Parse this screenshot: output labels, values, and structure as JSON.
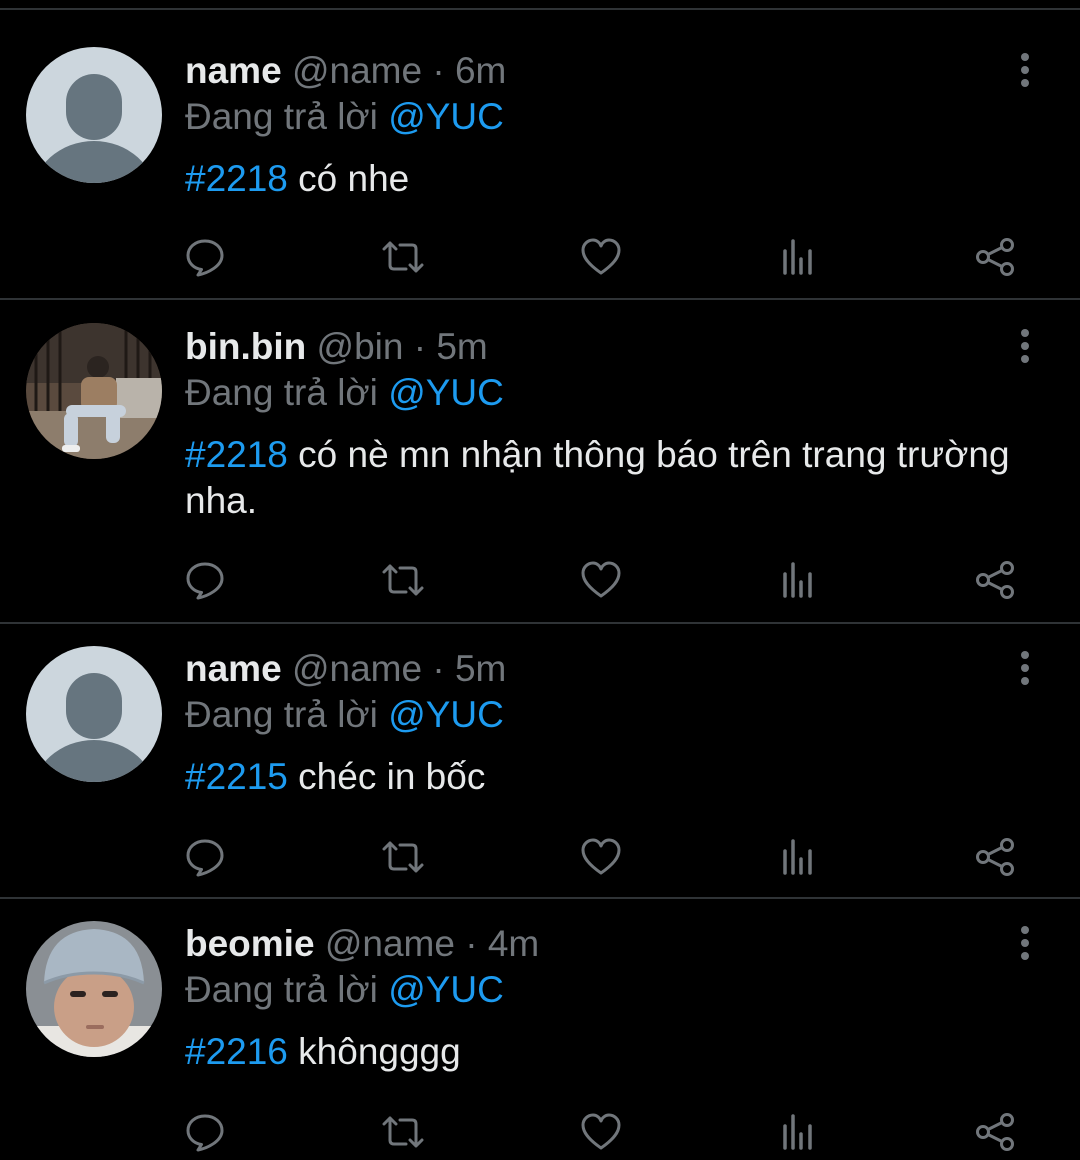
{
  "accent_color": "#1d9bf0",
  "muted_color": "#71767b",
  "tweets": [
    {
      "display_name": "name",
      "handle": "@name",
      "separator": "·",
      "time": "6m",
      "reply_prefix": "Đang trả lời",
      "reply_to": "@YUC",
      "hashtag": "#2218",
      "text": " có nhe",
      "avatar": "default-avatar-icon"
    },
    {
      "display_name": "bin.bin",
      "handle": "@bin",
      "separator": "·",
      "time": "5m",
      "reply_prefix": "Đang trả lời",
      "reply_to": "@YUC",
      "hashtag": "#2218",
      "text": " có nè mn nhận thông báo trên trang trường nha.",
      "avatar": "photo-avatar-sitting-person"
    },
    {
      "display_name": "name",
      "handle": "@name",
      "separator": "·",
      "time": "5m",
      "reply_prefix": "Đang trả lời",
      "reply_to": "@YUC",
      "hashtag": "#2215",
      "text": " chéc in bốc",
      "avatar": "default-avatar-icon"
    },
    {
      "display_name": "beomie",
      "handle": "@name",
      "separator": "·",
      "time": "4m",
      "reply_prefix": "Đang trả lời",
      "reply_to": "@YUC",
      "hashtag": "#2216",
      "text": " khôngggg",
      "avatar": "photo-avatar-beanie-person"
    }
  ],
  "action_icons": [
    "reply-icon",
    "retweet-icon",
    "like-icon",
    "views-icon",
    "share-icon"
  ],
  "more_icon": "more-vertical-icon"
}
